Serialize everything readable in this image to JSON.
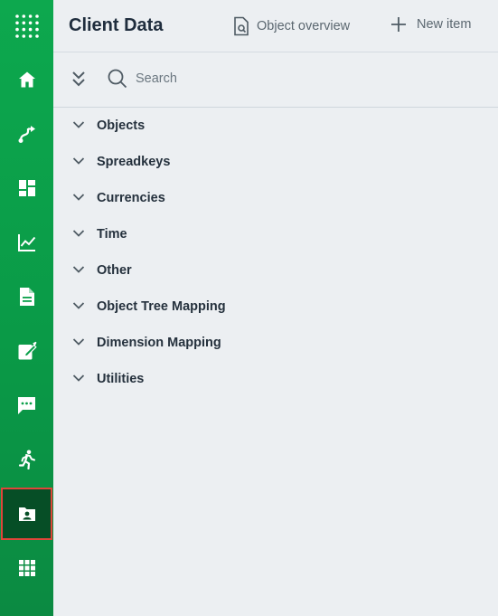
{
  "header": {
    "title": "Client Data",
    "actions": [
      {
        "label": "Object overview",
        "icon": "document-search-icon"
      },
      {
        "label": "New item",
        "icon": "plus-icon"
      }
    ]
  },
  "toolbar": {
    "search_placeholder": "Search"
  },
  "sidebar": {
    "items": [
      {
        "name": "app-launcher",
        "icon": "grid-dots-icon"
      },
      {
        "name": "home",
        "icon": "home-icon"
      },
      {
        "name": "routes",
        "icon": "route-icon"
      },
      {
        "name": "dashboard",
        "icon": "dashboard-icon"
      },
      {
        "name": "analytics",
        "icon": "chart-line-icon"
      },
      {
        "name": "documents",
        "icon": "document-icon"
      },
      {
        "name": "edit",
        "icon": "edit-icon"
      },
      {
        "name": "messages",
        "icon": "chat-icon"
      },
      {
        "name": "activity",
        "icon": "run-icon"
      },
      {
        "name": "client-data",
        "icon": "contact-folder-icon",
        "active": true
      },
      {
        "name": "apps",
        "icon": "apps-grid-icon"
      }
    ],
    "active_color": "#064e26",
    "highlight_color": "#e0453a"
  },
  "tree": {
    "items": [
      {
        "label": "Objects"
      },
      {
        "label": "Spreadkeys"
      },
      {
        "label": "Currencies"
      },
      {
        "label": "Time"
      },
      {
        "label": "Other"
      },
      {
        "label": "Object Tree Mapping"
      },
      {
        "label": "Dimension Mapping"
      },
      {
        "label": "Utilities"
      }
    ]
  }
}
